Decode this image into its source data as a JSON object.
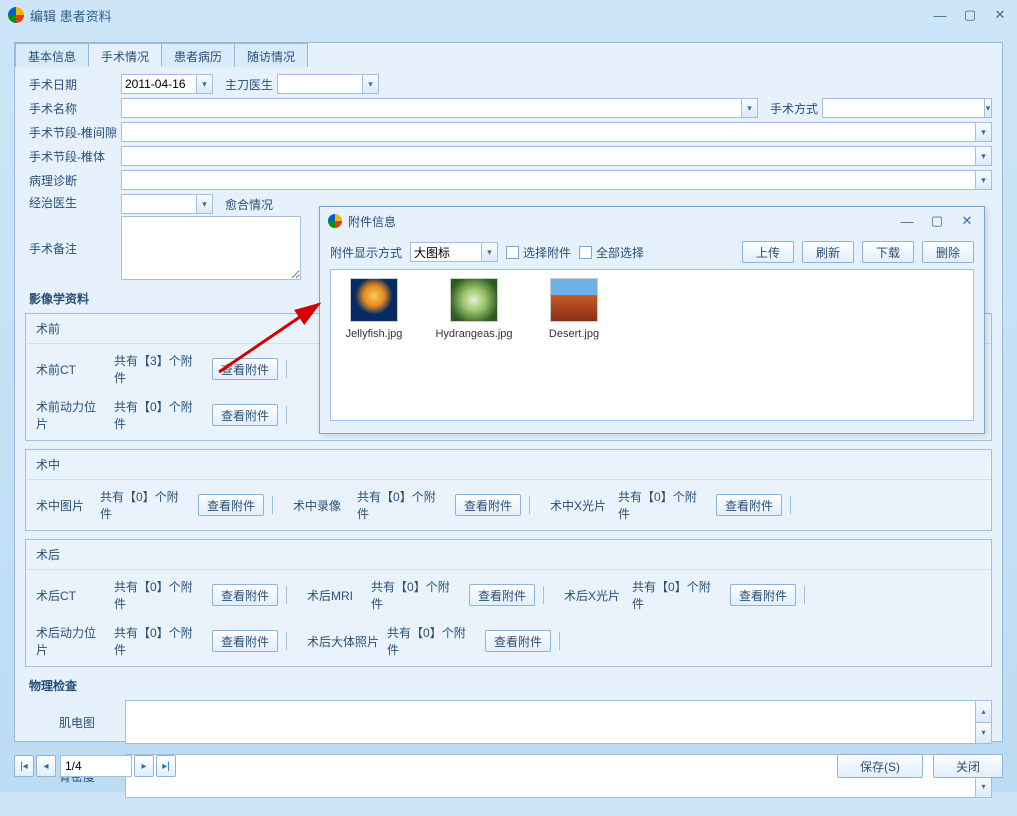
{
  "window": {
    "title": "编辑  患者资料"
  },
  "tabs": {
    "t0": "基本信息",
    "t1": "手术情况",
    "t2": "患者病历",
    "t3": "随访情况"
  },
  "form": {
    "surgery_date_lbl": "手术日期",
    "surgery_date_val": "2011-04-16",
    "surgeon_lbl": "主刀医生",
    "surgery_name_lbl": "手术名称",
    "surgery_method_lbl": "手术方式",
    "segment_disc_lbl": "手术节段-椎间隙",
    "segment_body_lbl": "手术节段-椎体",
    "pathology_lbl": "病理诊断",
    "attending_lbl": "经治医生",
    "healing_lbl": "愈合情况",
    "remark_lbl": "手术备注"
  },
  "imaging": {
    "title": "影像学资料",
    "pre": {
      "title": "术前",
      "ct_lbl": "术前CT",
      "ct_count": "共有【3】个附件",
      "dyn_lbl": "术前动力位片",
      "dyn_count": "共有【0】个附件"
    },
    "intra": {
      "title": "术中",
      "pic_lbl": "术中图片",
      "pic_count": "共有【0】个附件",
      "vid_lbl": "术中录像",
      "vid_count": "共有【0】个附件",
      "xray_lbl": "术中X光片",
      "xray_count": "共有【0】个附件"
    },
    "post": {
      "title": "术后",
      "ct_lbl": "术后CT",
      "ct_count": "共有【0】个附件",
      "mri_lbl": "术后MRI",
      "mri_count": "共有【0】个附件",
      "xray_lbl": "术后X光片",
      "xray_count": "共有【0】个附件",
      "dyn_lbl": "术后动力位片",
      "dyn_count": "共有【0】个附件",
      "gross_lbl": "术后大体照片",
      "gross_count": "共有【0】个附件"
    },
    "view_btn": "查看附件"
  },
  "physical": {
    "title": "物理检查",
    "emg_lbl": "肌电图",
    "bmd_lbl": "骨密度"
  },
  "footer": {
    "page": "1/4",
    "save": "保存(S)",
    "close": "关闭"
  },
  "popup": {
    "title": "附件信息",
    "display_lbl": "附件显示方式",
    "display_val": "大图标",
    "select_lbl": "选择附件",
    "select_all_lbl": "全部选择",
    "upload": "上传",
    "refresh": "刷新",
    "download": "下载",
    "delete": "删除",
    "files": {
      "f0": "Jellyfish.jpg",
      "f1": "Hydrangeas.jpg",
      "f2": "Desert.jpg"
    }
  }
}
